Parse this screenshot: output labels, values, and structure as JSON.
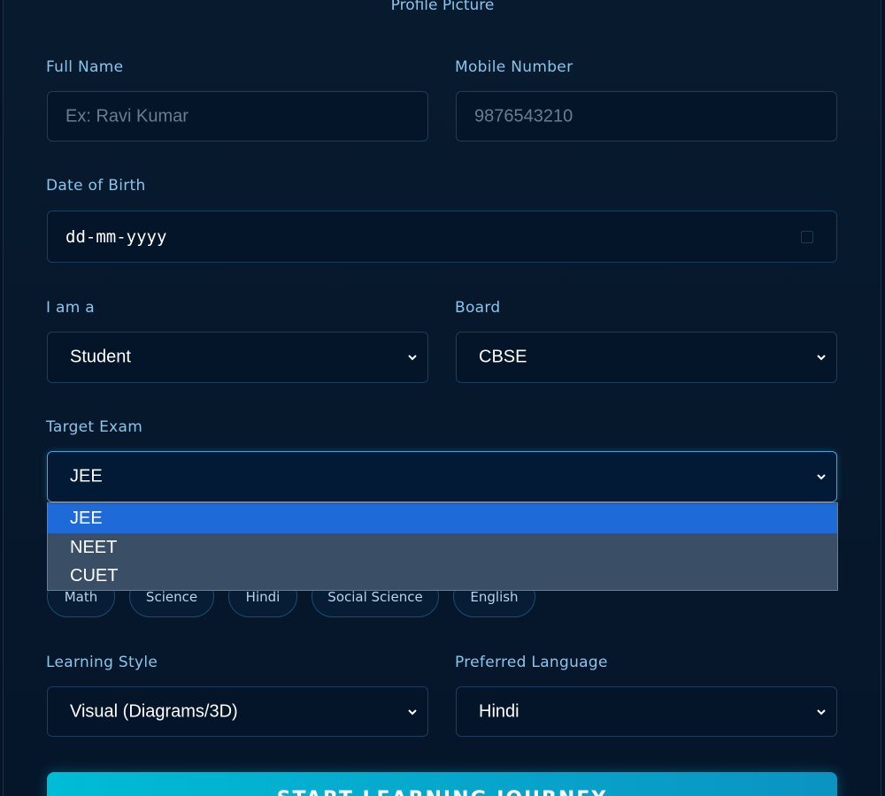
{
  "profile": {
    "picture_label": "Profile Picture"
  },
  "full_name": {
    "label": "Full Name",
    "placeholder": "Ex: Ravi Kumar"
  },
  "mobile": {
    "label": "Mobile Number",
    "placeholder": "9876543210"
  },
  "dob": {
    "label": "Date of Birth",
    "placeholder": "dd-mm-yyyy"
  },
  "role": {
    "label": "I am a",
    "value": "Student"
  },
  "board": {
    "label": "Board",
    "value": "CBSE"
  },
  "target_exam": {
    "label": "Target Exam",
    "value": "JEE",
    "options": [
      "JEE",
      "NEET",
      "CUET"
    ]
  },
  "subjects": [
    "Math",
    "Science",
    "Hindi",
    "Social Science",
    "English"
  ],
  "learning_style": {
    "label": "Learning Style",
    "value": "Visual (Diagrams/3D)"
  },
  "language": {
    "label": "Preferred Language",
    "value": "Hindi"
  },
  "cta": {
    "label": "START LEARNING JOURNEY"
  },
  "colors": {
    "accent": "#00bcd6",
    "selected_option": "#1e6ad8",
    "label": "#8cc4ea"
  }
}
